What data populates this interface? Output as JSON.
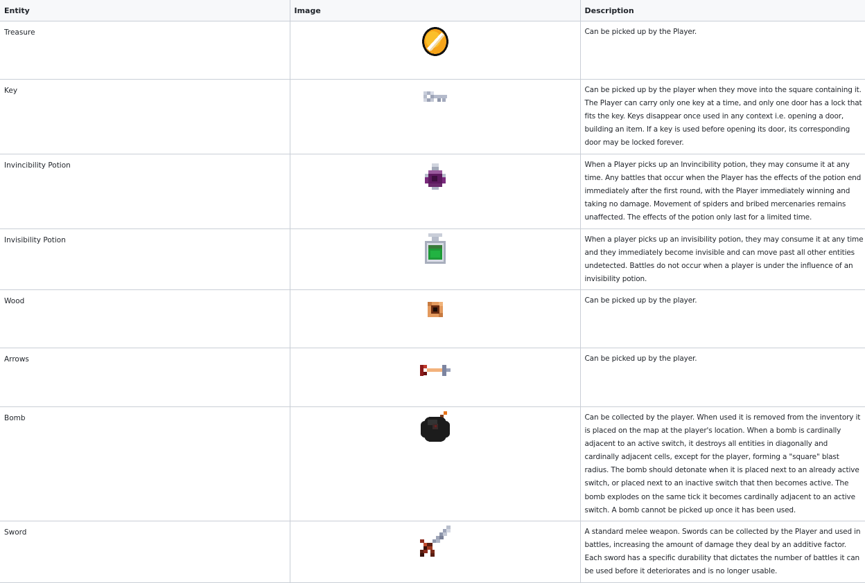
{
  "table": {
    "headers": {
      "entity": "Entity",
      "image": "Image",
      "description": "Description"
    },
    "rows": [
      {
        "entity": "Treasure",
        "icon": "treasure-coin-icon",
        "description": "Can be picked up by the Player."
      },
      {
        "entity": "Key",
        "icon": "key-icon",
        "description": "Can be picked up by the player when they move into the square containing it. The Player can carry only one key at a time, and only one door has a lock that fits the key. Keys disappear once used in any context i.e. opening a door, building an item. If a key is used before opening its door, its corresponding door may be locked forever."
      },
      {
        "entity": "Invincibility Potion",
        "icon": "invincibility-potion-icon",
        "description": "When a Player picks up an Invincibility potion, they may consume it at any time. Any battles that occur when the Player has the effects of the potion end immediately after the first round, with the Player immediately winning and taking no damage. Movement of spiders and bribed mercenaries remains unaffected. The effects of the potion only last for a limited time."
      },
      {
        "entity": "Invisibility Potion",
        "icon": "invisibility-potion-icon",
        "description": "When a player picks up an invisibility potion, they may consume it at any time and they immediately become invisible and can move past all other entities undetected. Battles do not occur when a player is under the influence of an invisibility potion."
      },
      {
        "entity": "Wood",
        "icon": "wood-icon",
        "description": "Can be picked up by the player."
      },
      {
        "entity": "Arrows",
        "icon": "arrow-icon",
        "description": "Can be picked up by the player."
      },
      {
        "entity": "Bomb",
        "icon": "bomb-icon",
        "description": "Can be collected by the player. When used it is removed from the inventory it is placed on the map at the player's location. When a bomb is cardinally adjacent to an active switch, it destroys all entities in diagonally and cardinally adjacent cells, except for the player, forming a \"square\" blast radius. The bomb should detonate when it is placed next to an already active switch, or placed next to an inactive switch that then becomes active. The bomb explodes on the same tick it becomes cardinally adjacent to an active switch. A bomb cannot be picked up once it has been used."
      },
      {
        "entity": "Sword",
        "icon": "sword-icon",
        "description": "A standard melee weapon. Swords can be collected by the Player and used in battles, increasing the amount of damage they deal by an additive factor. Each sword has a specific durability that dictates the number of battles it can be used before it deteriorates and is no longer usable."
      }
    ]
  }
}
